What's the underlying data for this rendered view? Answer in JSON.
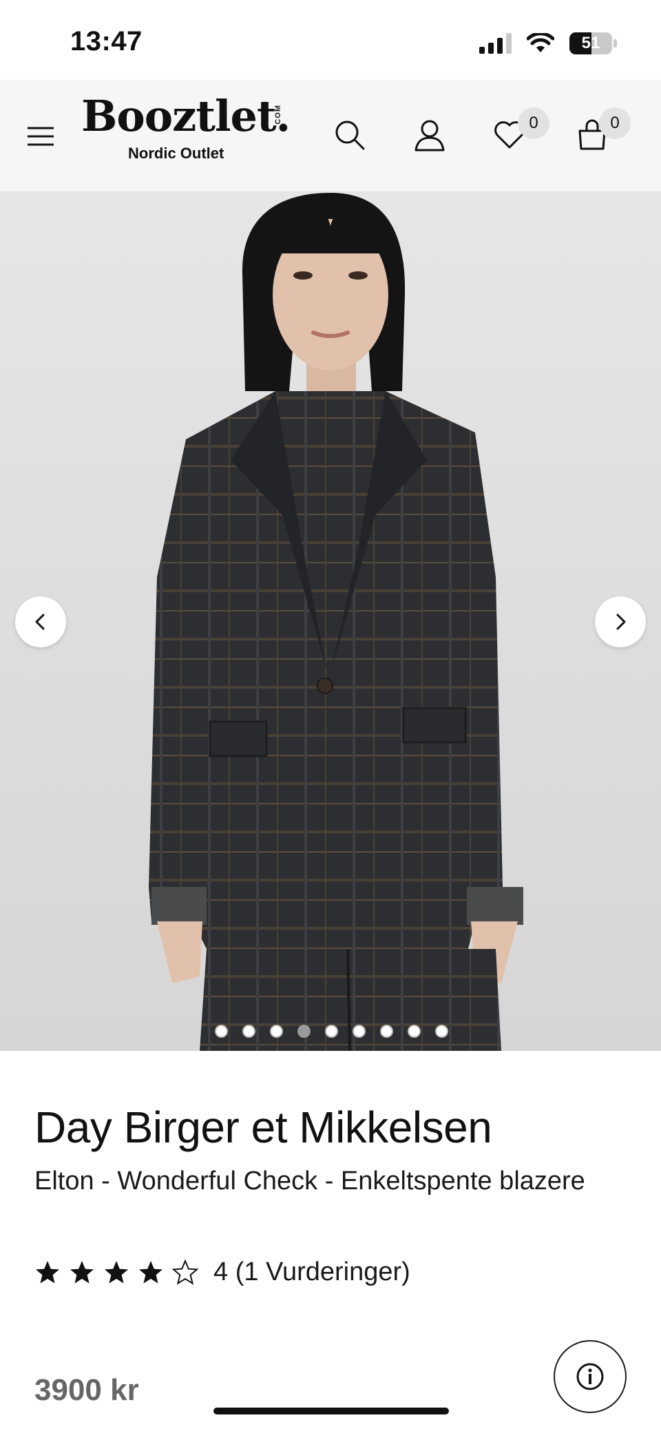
{
  "status_bar": {
    "time": "13:47",
    "battery": "51",
    "battery_level": 0.51
  },
  "header": {
    "logo_text": "Booztlet.",
    "logo_com": "COM",
    "logo_sub": "Nordic Outlet",
    "wishlist_count": "0",
    "cart_count": "0",
    "icons": [
      "menu-icon",
      "search-icon",
      "user-icon",
      "heart-icon",
      "bag-icon"
    ]
  },
  "carousel": {
    "total_images": 9,
    "active_index": 3
  },
  "product": {
    "brand": "Day Birger et Mikkelsen",
    "name": "Elton - Wonderful Check - Enkeltspente blazere",
    "rating": 4,
    "rating_max": 5,
    "rating_text": "4 (1 Vurderinger)",
    "price": "3900 kr"
  },
  "colors": {
    "header_bg": "#f6f6f6",
    "badge_bg": "#e2e2e2",
    "price": "#666666",
    "text": "#1a1a1a"
  }
}
